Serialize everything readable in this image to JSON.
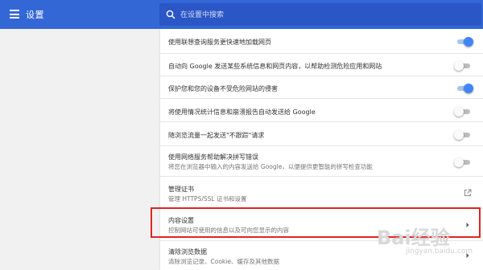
{
  "app": {
    "title": "设置"
  },
  "search": {
    "placeholder": "在设置中搜索"
  },
  "rows": [
    {
      "label": "使用联想查询服务更快速地加载网页",
      "control": "toggle",
      "state": "on"
    },
    {
      "label": "自动向 Google 发送某些系统信息和网页内容，以帮助检测危险应用和网站",
      "control": "toggle",
      "state": "off"
    },
    {
      "label": "保护您和您的设备不受危险网站的侵害",
      "control": "toggle",
      "state": "on"
    },
    {
      "label": "将使用情况统计信息和崩溃报告自动发送给 Google",
      "control": "toggle",
      "state": "off"
    },
    {
      "label": "随浏览流量一起发送\"不跟踪\"请求",
      "control": "toggle",
      "state": "off"
    },
    {
      "label": "使用网络服务帮助解决拼写错误",
      "sub": "将您在浏览器中输入的内容发送给 Google，以便提供更智能的拼写检查功能",
      "control": "toggle",
      "state": "off"
    },
    {
      "label": "管理证书",
      "sub": "管理 HTTPS/SSL 证书和设置",
      "control": "external-link"
    },
    {
      "label": "内容设置",
      "sub": "控制网站可使用的信息以及可向您显示的内容",
      "control": "chevron",
      "highlighted": true
    },
    {
      "label": "清除浏览数据",
      "sub": "清除浏览记录、Cookie、缓存及其他数据",
      "control": "chevron"
    }
  ],
  "colors": {
    "header": "#3367d6",
    "search_bg": "#2a56c6",
    "toggle_on": "#4285f4",
    "highlight_box": "#e02424"
  },
  "watermark": {
    "logo": "Bai经验",
    "url": "jingyan.baidu.com"
  }
}
